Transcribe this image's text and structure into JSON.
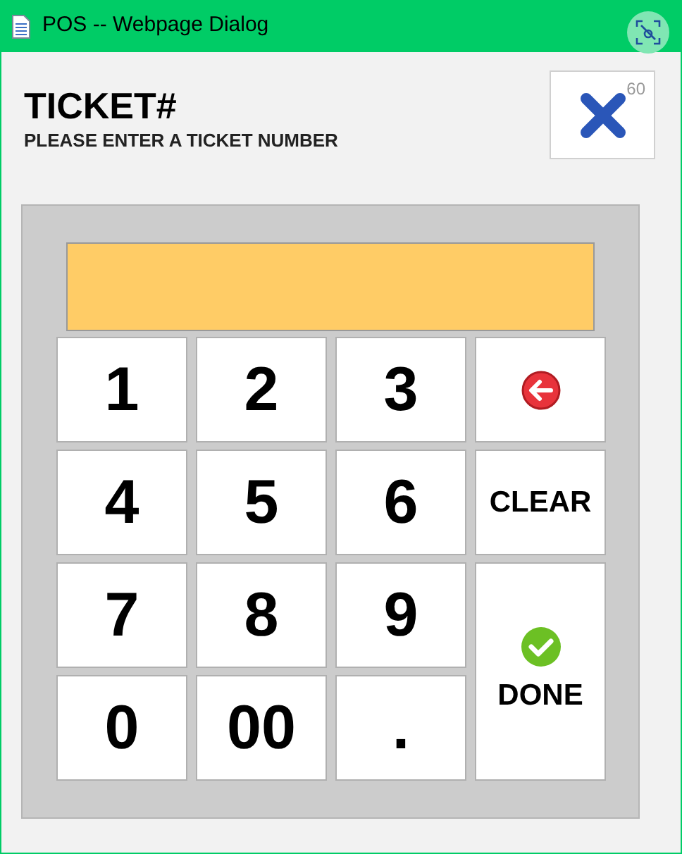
{
  "window": {
    "title": "POS -- Webpage Dialog"
  },
  "header": {
    "title": "TICKET#",
    "subtitle": "PLEASE ENTER A TICKET NUMBER"
  },
  "close_button": {
    "countdown": "60"
  },
  "keys": [
    {
      "kind": "digit",
      "label": "1"
    },
    {
      "kind": "digit",
      "label": "2"
    },
    {
      "kind": "digit",
      "label": "3"
    },
    {
      "kind": "backspace"
    },
    {
      "kind": "digit",
      "label": "4"
    },
    {
      "kind": "digit",
      "label": "5"
    },
    {
      "kind": "digit",
      "label": "6"
    },
    {
      "kind": "clear",
      "label": "CLEAR"
    },
    {
      "kind": "digit",
      "label": "7"
    },
    {
      "kind": "digit",
      "label": "8"
    },
    {
      "kind": "digit",
      "label": "9"
    },
    {
      "kind": "done",
      "label": "DONE"
    },
    {
      "kind": "digit",
      "label": "0"
    },
    {
      "kind": "digit",
      "label": "00"
    },
    {
      "kind": "digit",
      "label": "."
    }
  ]
}
